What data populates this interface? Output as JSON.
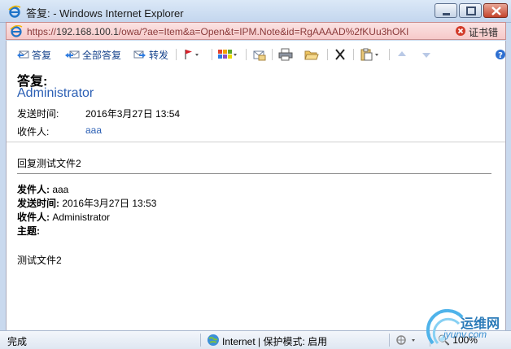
{
  "window": {
    "title": "答复: - Windows Internet Explorer",
    "close_color": "#c4442c"
  },
  "address": {
    "url_prefix": "https://",
    "url_host": "192.168.100.1",
    "url_path": "/owa/?ae=Item&a=Open&t=IPM.Note&id=RgAAAAD%2fKUu3hOKl",
    "cert_error": "证书错误",
    "bar_color": "#f6c9c9"
  },
  "toolbar": {
    "reply_label": "答复",
    "reply_all_label": "全部答复",
    "forward_label": "转发"
  },
  "message": {
    "subject": "答复:",
    "sender": "Administrator",
    "sent_label": "发送时间:",
    "sent_value": "2016年3月27日  13:54",
    "to_label": "收件人:",
    "to_value": "aaa",
    "body_first": "回复测试文件2",
    "quoted": {
      "from_label": "发件人:",
      "from_value": " aaa",
      "sent_label": "发送时间:",
      "sent_value": " 2016年3月27日  13:53",
      "to_label": "收件人:",
      "to_value": " Administrator",
      "subject_label": "主题:",
      "body": "测试文件2"
    }
  },
  "status": {
    "left": "完成",
    "zone": "Internet | 保护模式: 启用",
    "zoom": "100%"
  },
  "watermark": {
    "cn": "运维网",
    "en": "iyunv.com"
  }
}
